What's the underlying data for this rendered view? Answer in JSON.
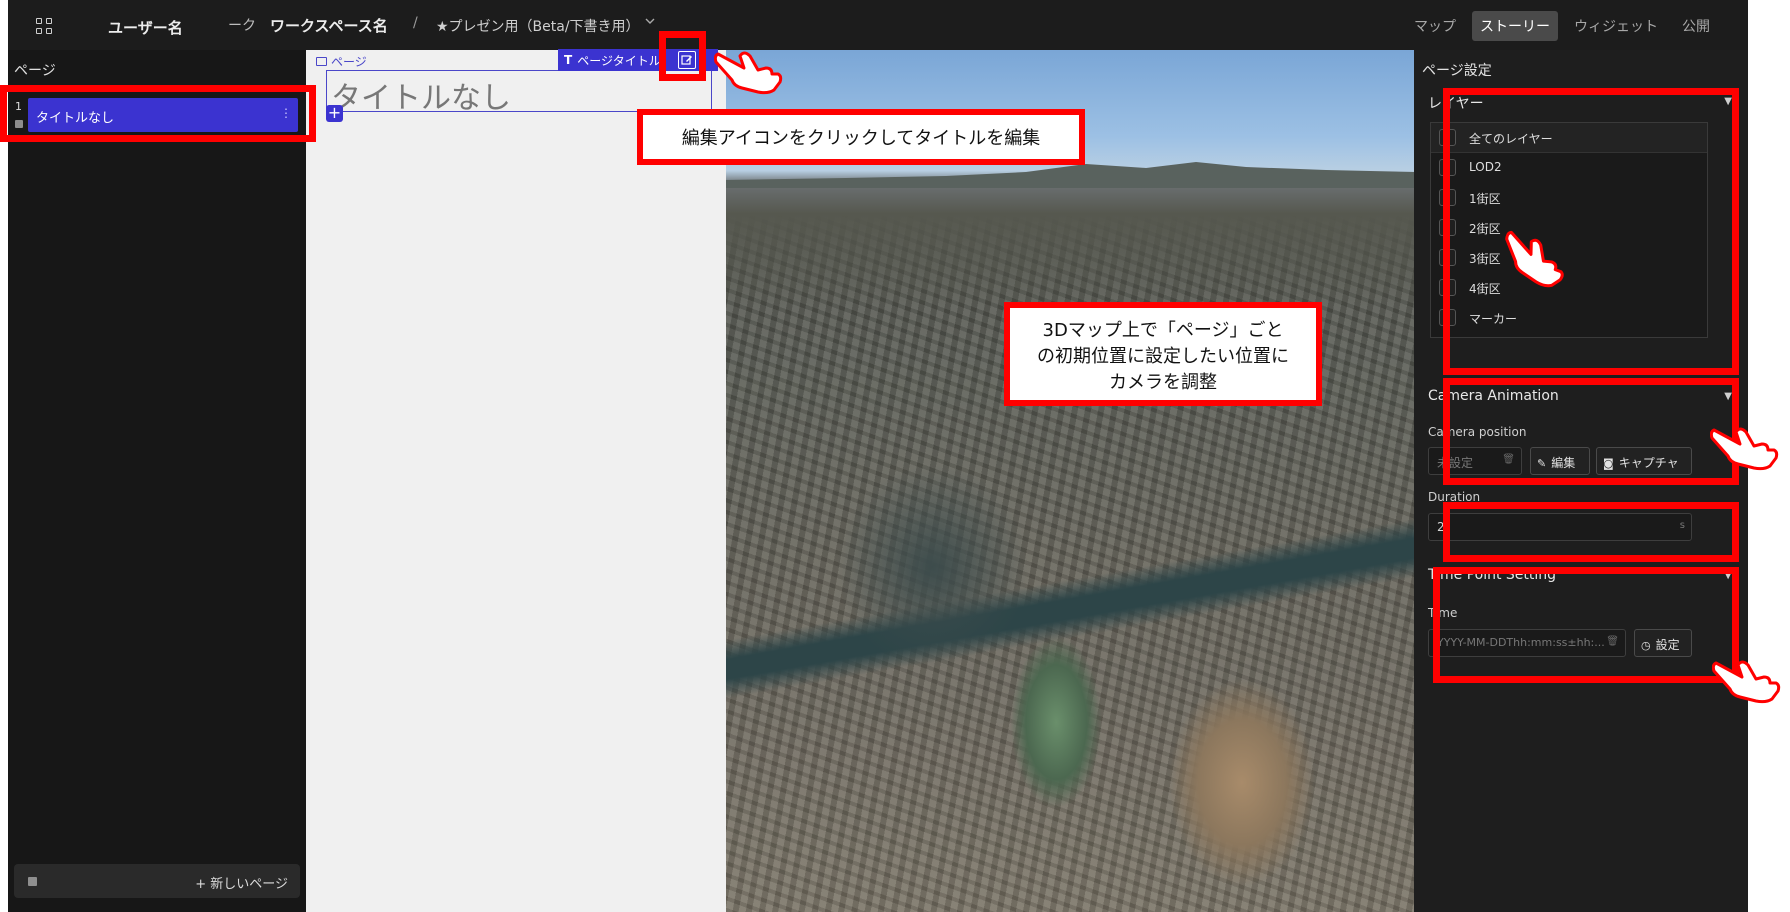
{
  "header": {
    "apps_icon": "grid-icon",
    "user_name": "ユーザー名",
    "workspace_prefix": "ーク",
    "workspace_name": "ワークスペース名",
    "separator": "/",
    "project_name": "★プレゼン用（Beta/下書き用）",
    "project_chevron": "chevron-down-icon",
    "tabs": [
      {
        "label": "マップ",
        "active": false
      },
      {
        "label": "ストーリー",
        "active": true
      },
      {
        "label": "ウィジェット",
        "active": false
      },
      {
        "label": "公開",
        "active": false
      }
    ]
  },
  "left_panel": {
    "title": "ページ",
    "pages": [
      {
        "number": "1",
        "label": "タイトルなし",
        "selected": true
      }
    ],
    "new_page_label": "+ 新しいページ"
  },
  "story": {
    "page_label": "ページ",
    "toolbar_label": "ページタイトル",
    "title_text": "タイトルなし",
    "edit_icon": "edit-icon",
    "add_icon": "plus-icon"
  },
  "right_panel": {
    "title": "ページ設定",
    "layers": {
      "heading": "レイヤー",
      "all_label": "全てのレイヤー",
      "items": [
        "LOD2",
        "1街区",
        "2街区",
        "3街区",
        "4街区",
        "マーカー"
      ]
    },
    "camera_animation": {
      "heading": "Camera Animation",
      "position_label": "Camera position",
      "position_placeholder": "未設定",
      "edit_button": "編集",
      "capture_button": "キャプチャ",
      "duration_label": "Duration",
      "duration_value": "2",
      "duration_unit": "s"
    },
    "time_point": {
      "heading": "Time Point Setting",
      "time_label": "Time",
      "time_placeholder": "YYYY-MM-DDThh:mm:ss±hh:...",
      "set_button": "設定"
    }
  },
  "annotations": {
    "edit_title_note": "編集アイコンをクリックしてタイトルを編集",
    "camera_note_line1": "3Dマップ上で「ページ」ごと",
    "camera_note_line2": "の初期位置に設定したい位置に",
    "camera_note_line3": "カメラを調整",
    "highlight_color": "#ff0000",
    "pointer_icon": "hand-pointer-icon"
  },
  "colors": {
    "accent": "#3b33d0",
    "app_bg": "#171717",
    "story_bg": "#f0f0f0"
  }
}
